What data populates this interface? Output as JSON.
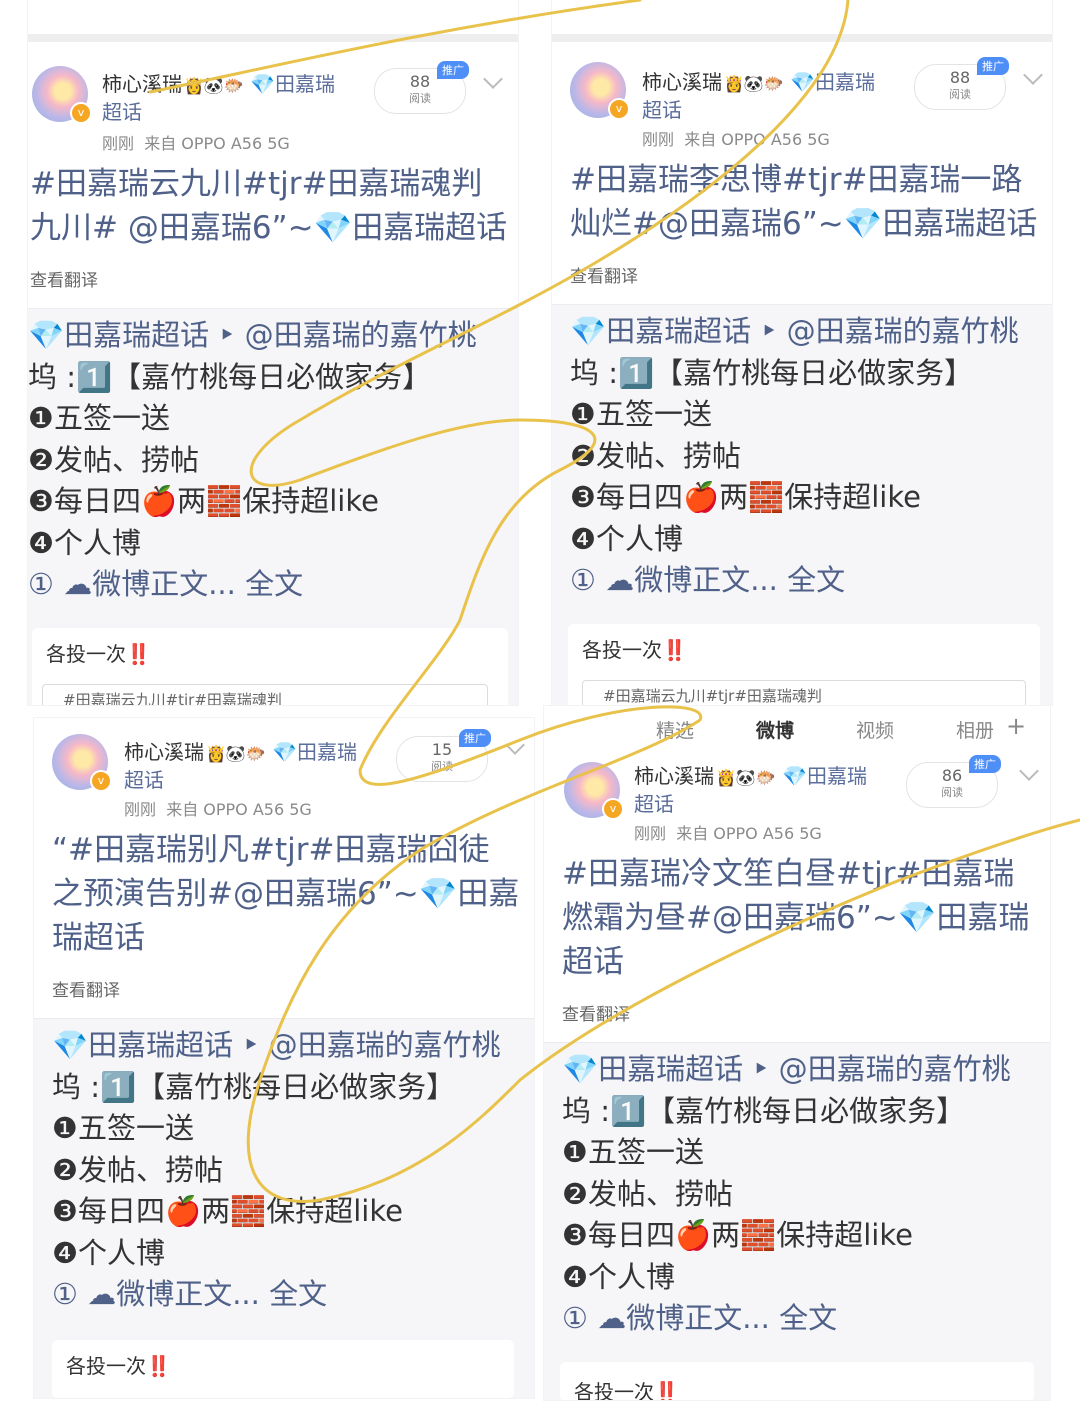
{
  "posts": [
    {
      "username": "柿心溪瑞",
      "emojis": "👸🐼🐡",
      "topic": "💎田嘉瑞",
      "topic_sub": "超话",
      "time": "刚刚",
      "source": "来自 OPPO A56 5G",
      "reads": "88",
      "reads_label": "阅读",
      "ad_label": "推广",
      "title_lines": [
        "#田嘉瑞云九川#tjr#田嘉瑞魂判",
        "九川# @田嘉瑞6”~💎田嘉瑞超话"
      ],
      "translate": "查看翻译",
      "repost_lines": [
        "💎田嘉瑞超话 ‣ @田嘉瑞的嘉竹桃",
        "坞 :1️⃣【嘉竹桃每日必做家务】",
        "❶五签一送",
        "❷发帖、捞帖",
        "❸每日四🍎两🧱保持超like",
        "❹个人博",
        "① ☁微博正文... 全文"
      ],
      "vote_text": "各投一次",
      "vote_mark": "‼️",
      "option_text": "#田嘉瑞云九川#tjr#田嘉瑞魂判"
    },
    {
      "username": "柿心溪瑞",
      "emojis": "👸🐼🐡",
      "topic": "💎田嘉瑞",
      "topic_sub": "超话",
      "time": "刚刚",
      "source": "来自 OPPO A56 5G",
      "reads": "88",
      "reads_label": "阅读",
      "ad_label": "推广",
      "title_lines": [
        "#田嘉瑞李思博#tjr#田嘉瑞一路",
        "灿烂#@田嘉瑞6”~💎田嘉瑞超话"
      ],
      "translate": "查看翻译",
      "repost_lines": [
        "💎田嘉瑞超话 ‣ @田嘉瑞的嘉竹桃",
        "坞 :1️⃣【嘉竹桃每日必做家务】",
        "❶五签一送",
        "❷发帖、捞帖",
        "❸每日四🍎两🧱保持超like",
        "❹个人博",
        "① ☁微博正文... 全文"
      ],
      "vote_text": "各投一次",
      "vote_mark": "‼️",
      "option_text": "#田嘉瑞云九川#tjr#田嘉瑞魂判"
    },
    {
      "username": "柿心溪瑞",
      "emojis": "👸🐼🐡",
      "topic": "💎田嘉瑞",
      "topic_sub": "超话",
      "time": "刚刚",
      "source": "来自 OPPO A56 5G",
      "reads": "15",
      "reads_label": "阅读",
      "ad_label": "推广",
      "title_lines": [
        "“#田嘉瑞别凡#tjr#田嘉瑞囧徒",
        "之预演告别#@田嘉瑞6”~💎田嘉",
        "瑞超话"
      ],
      "translate": "查看翻译",
      "repost_lines": [
        "💎田嘉瑞超话 ‣ @田嘉瑞的嘉竹桃",
        "坞 :1️⃣【嘉竹桃每日必做家务】",
        "❶五签一送",
        "❷发帖、捞帖",
        "❸每日四🍎两🧱保持超like",
        "❹个人博",
        "① ☁微博正文... 全文"
      ],
      "vote_text": "各投一次",
      "vote_mark": "‼️"
    },
    {
      "username": "柿心溪瑞",
      "emojis": "👸🐼🐡",
      "topic": "💎田嘉瑞",
      "topic_sub": "超话",
      "time": "刚刚",
      "source": "来自 OPPO A56 5G",
      "reads": "86",
      "reads_label": "阅读",
      "ad_label": "推广",
      "title_lines": [
        "#田嘉瑞冷文笙白昼#tjr#田嘉瑞",
        "燃霜为昼#@田嘉瑞6”~💎田嘉瑞",
        "超话"
      ],
      "translate": "查看翻译",
      "repost_lines": [
        "💎田嘉瑞超话 ‣ @田嘉瑞的嘉竹桃",
        "坞 :1️⃣【嘉竹桃每日必做家务】",
        "❶五签一送",
        "❷发帖、捞帖",
        "❸每日四🍎两🧱保持超like",
        "❹个人博",
        "① ☁微博正文... 全文"
      ],
      "vote_text": "各投一次",
      "vote_mark": "‼️"
    }
  ],
  "nav_tabs": [
    "精选",
    "微博",
    "视频",
    "相册"
  ],
  "nav_plus": "+",
  "annotation_color": "#e8c24a"
}
